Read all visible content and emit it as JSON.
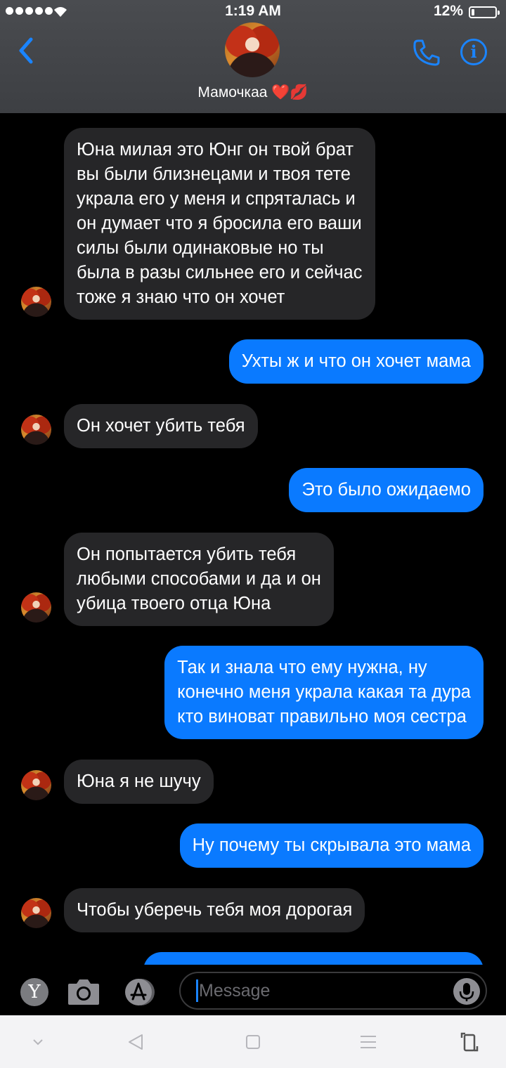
{
  "status": {
    "time": "1:19 AM",
    "battery_percent": "12%",
    "battery_level": 0.12,
    "signal_icon": "signal-dots-icon",
    "wifi_icon": "wifi-icon"
  },
  "header": {
    "contact_name": "Мамочкаа ❤️💋",
    "back_icon": "chevron-left-icon",
    "call_icon": "phone-icon",
    "info_icon": "info-icon",
    "info_glyph": "i",
    "accent_color": "#1a84ff"
  },
  "messages": [
    {
      "direction": "incoming",
      "text": "Юна милая это Юнг он твой брат\nвы были близнецами и твоя тете\nукрала его у меня и спряталась и\nон думает что я бросила его ваши\nсилы были одинаковые но ты\nбыла в разы сильнее его и сейчас\nтоже я знаю что он хочет"
    },
    {
      "direction": "outgoing",
      "text": "Ухты ж и что он хочет мама"
    },
    {
      "direction": "incoming",
      "text": "Он хочет убить тебя"
    },
    {
      "direction": "outgoing",
      "text": "Это было ожидаемо"
    },
    {
      "direction": "incoming",
      "text": "Он попытается убить тебя\nлюбыми способами и да и он\nубица твоего отца Юна"
    },
    {
      "direction": "outgoing",
      "text": "Так и знала что ему нужна, ну\nконечно меня украла какая та дура\nкто виноват правильно моя сестра"
    },
    {
      "direction": "incoming",
      "text": "Юна я не шучу"
    },
    {
      "direction": "outgoing",
      "text": "Ну почему ты скрывала это мама"
    },
    {
      "direction": "incoming",
      "text": "Чтобы уберечь тебя моя дорогая"
    },
    {
      "direction": "outgoing",
      "text": ""
    }
  ],
  "bubble_colors": {
    "incoming": "#262628",
    "outgoing": "#0a7aff"
  },
  "composer": {
    "y_button_label": "Y",
    "placeholder": "Message",
    "camera_icon": "camera-icon",
    "appstore_icon": "appstore-icon",
    "mic_icon": "microphone-icon"
  },
  "nav": {
    "icons": [
      "chevron-down-icon",
      "back-triangle-icon",
      "home-square-icon",
      "menu-lines-icon",
      "rotate-icon"
    ]
  }
}
